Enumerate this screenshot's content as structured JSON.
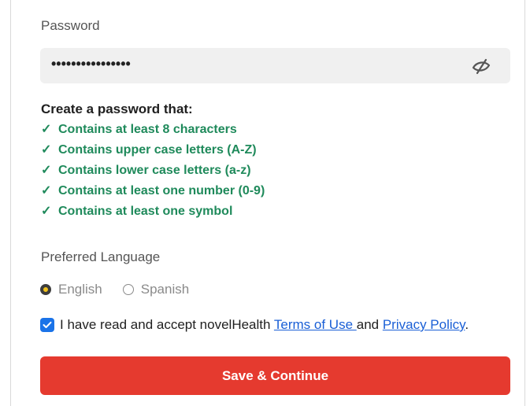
{
  "password": {
    "label": "Password",
    "value": "••••••••••••••••",
    "toggle_icon": "eye-slash-icon"
  },
  "requirements": {
    "heading": "Create a password that:",
    "check_mark": "✓",
    "items": [
      "Contains at least 8 characters",
      "Contains upper case letters (A-Z)",
      "Contains lower case letters (a-z)",
      "Contains at least one number (0-9)",
      "Contains at least one symbol"
    ],
    "color": "#1f8a5b"
  },
  "language": {
    "label": "Preferred Language",
    "options": [
      {
        "label": "English",
        "selected": true
      },
      {
        "label": "Spanish",
        "selected": false
      }
    ]
  },
  "terms": {
    "checked": true,
    "text_before": "I have read and accept novelHealth ",
    "terms_link": "Terms of Use ",
    "text_middle": "and ",
    "privacy_link": "Privacy Policy",
    "text_after": "."
  },
  "save_button": {
    "label": "Save & Continue",
    "color": "#e53a2f"
  }
}
